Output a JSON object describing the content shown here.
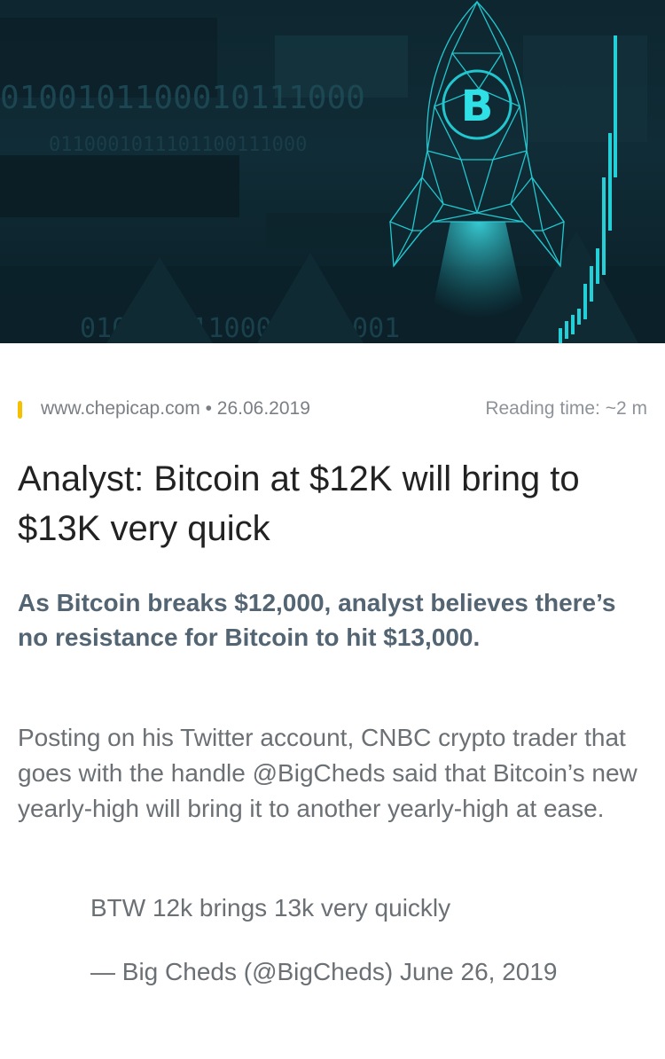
{
  "hero": {
    "image_name": "bitcoin-rocket-illustration",
    "rocket_symbol": "B",
    "binary_rows": [
      "0100101100010111000",
      "0110001011101100111000",
      "01000101100010111001"
    ],
    "accent_color": "#23d0d8"
  },
  "meta": {
    "source": "www.chepicap.com",
    "separator": "•",
    "date": "26.06.2019",
    "reading_time": "Reading time: ~2 m",
    "accent_color": "#f4c000"
  },
  "article": {
    "title": "Analyst: Bitcoin at $12K will bring to $13K very quick",
    "lead": "As Bitcoin breaks $12,000, analyst believes there’s no resistance for Bitcoin to hit $13,000.",
    "body": "Posting on his Twitter account, CNBC crypto trader that goes with the handle @BigCheds said that Bitcoin’s new yearly-high will bring it to another yearly-high at ease.",
    "quote": "BTW 12k brings 13k very quickly",
    "quote_attribution": "— Big Cheds (@BigCheds) June 26, 2019"
  }
}
